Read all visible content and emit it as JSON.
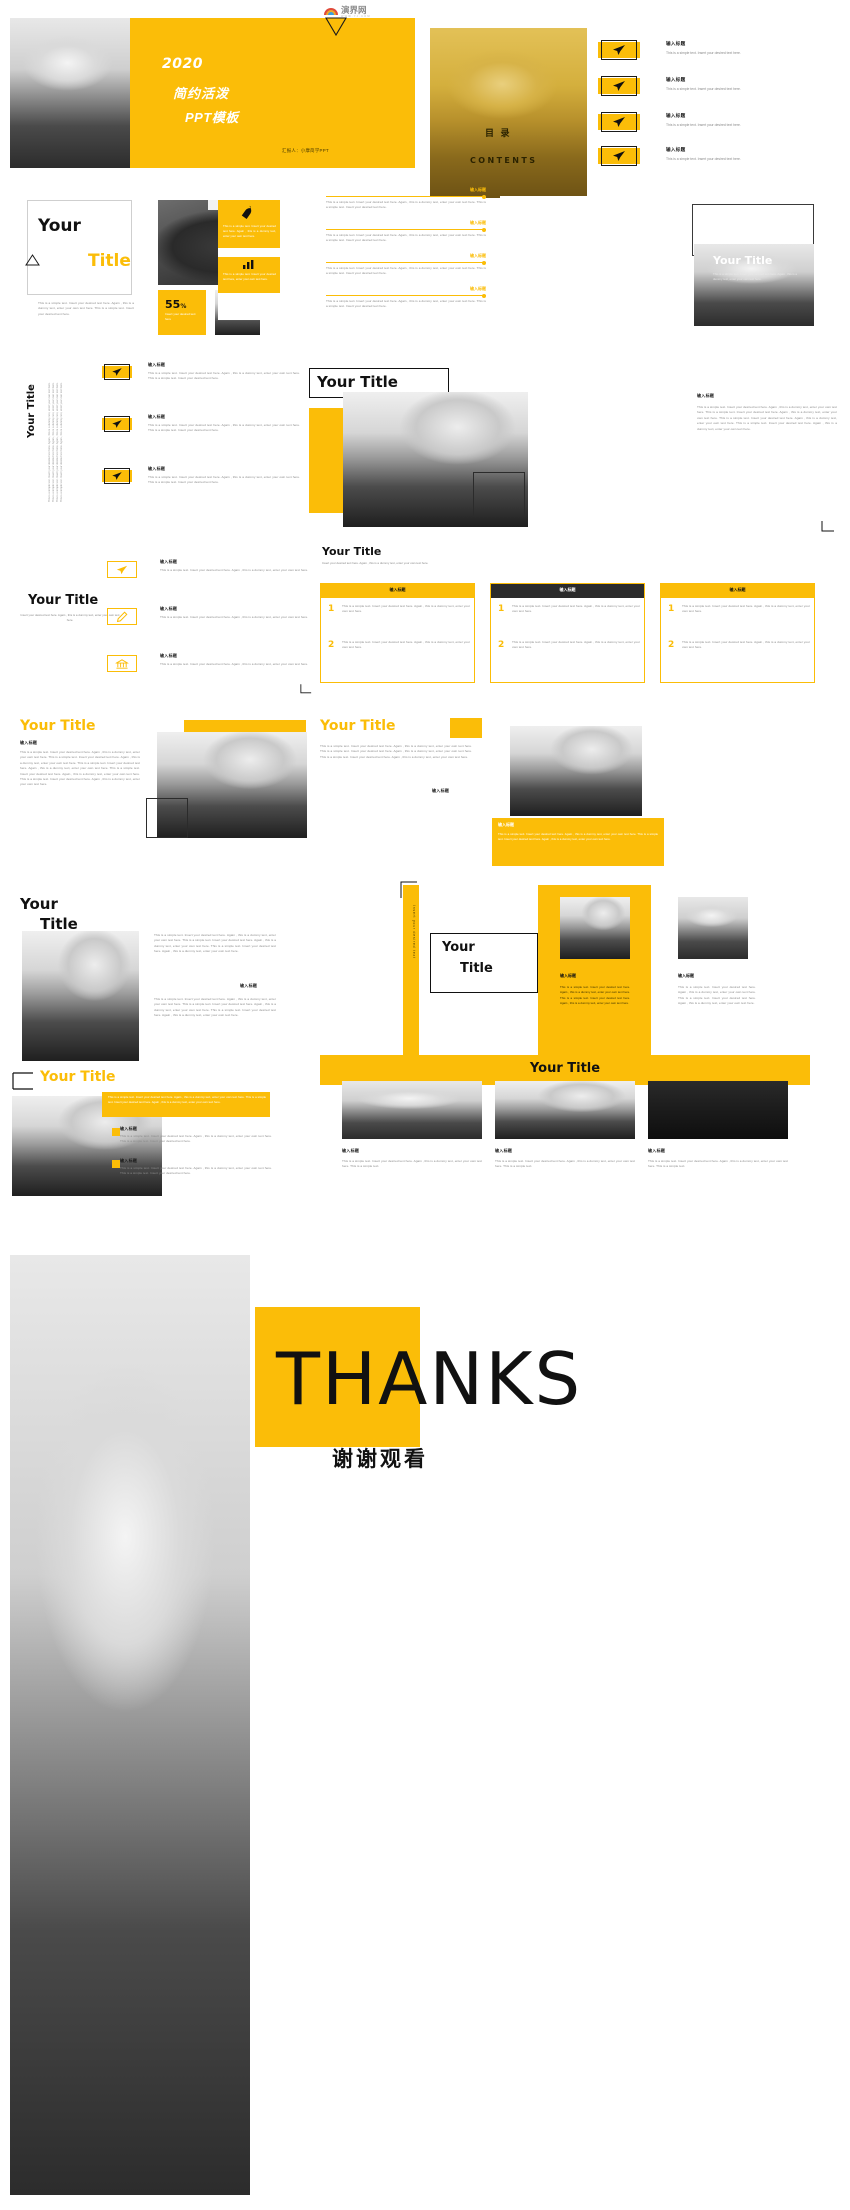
{
  "meta": {
    "watermark": "演界网",
    "watermark_sub": "WWW.YJ.COM"
  },
  "colors": {
    "accent": "#FBBD08",
    "accent_dark": "#E8AE05",
    "ink": "#1a1a1a",
    "muted": "#8a8a8a"
  },
  "lorem": {
    "short": "This is a simple text. Insert your desired text here.",
    "medium": "This is a simple text. Insert your desired text here. Again , this is a dummy text, enter your own text here.",
    "long": "This is a simple text. Insert your desired text here. Again , this is a dummy text, enter your own text here. This is a simple text. Insert your desired text here. Again , this is a dummy text, enter your own text here.",
    "xlong": "This is a simple text. Insert your desired text here. Again , this is a dummy text, enter your own text here. This is a simple text. Insert your desired text here. Again , this is a dummy text, enter your own text here. This is a simple text. Insert your desired text here. Again , this is a dummy text, enter your own text here.",
    "vertical": "Insert your desired text"
  },
  "slide_cover": {
    "year": "2020",
    "line2": "简约活泼",
    "line3": "PPT模板",
    "author": "汇报人：小摩简学PPT"
  },
  "slide_contents": {
    "cn": "目  录",
    "en": "CONTENTS",
    "items": [
      {
        "title": "输入标题",
        "desc": "This is a simple text. Insert your desired text here."
      },
      {
        "title": "输入标题",
        "desc": "This is a simple text. Insert your desired text here."
      },
      {
        "title": "输入标题",
        "desc": "This is a simple text. Insert your desired text here."
      },
      {
        "title": "输入标题",
        "desc": "This is a simple text. Insert your desired text here."
      }
    ]
  },
  "slide_yourtitle_bike": {
    "title_1": "Your",
    "title_2": "Title",
    "body": "This is a simple text. Insert your desired text here. Again , this is a dummy text, enter your own text here. This is a simple text. Insert your desired text here.",
    "stat_value": "55",
    "stat_unit": "%",
    "stat_label": "Insert your desired text here",
    "card_text": "This is a simple text. Insert your desired text here. Again , this is a dummy text, enter your own text here.",
    "card2_text": "This is a simple text. Insert your desired text here, enter your own text here."
  },
  "slide_three_bars": {
    "items": [
      {
        "title": "输入标题",
        "body": "This is a simple text. Insert your desired text here. Again , this is a dummy text, enter your own text here. This is a simple text. Insert your desired text here."
      },
      {
        "title": "输入标题",
        "body": "This is a simple text. Insert your desired text here. Again , this is a dummy text, enter your own text here. This is a simple text. Insert your desired text here."
      },
      {
        "title": "输入标题",
        "body": "This is a simple text. Insert your desired text here. Again , this is a dummy text, enter your own text here. This is a simple text. Insert your desired text here."
      },
      {
        "title": "输入标题",
        "body": "This is a simple text. Insert your desired text here. Again , this is a dummy text, enter your own text here. This is a simple text. Insert your desired text here."
      }
    ]
  },
  "slide_photo_title": {
    "title": "Your Title",
    "body": "This is a simple text. Insert your desired text here. Again , this is a dummy text, enter your own text here."
  },
  "slide_icon_list": {
    "title_1": "输入标题",
    "items": [
      {
        "title": "输入标题",
        "body": "This is a simple text. Insert your desired text here. Again , this is a dummy text, enter your own text here. This is a simple text. Insert your desired text here."
      },
      {
        "title": "输入标题",
        "body": "This is a simple text. Insert your desired text here. Again , this is a dummy text, enter your own text here. This is a simple text. Insert your desired text here."
      },
      {
        "title": "输入标题",
        "body": "This is a simple text. Insert your desired text here. Again , this is a dummy text, enter your own text here. This is a simple text. Insert your desired text here."
      }
    ]
  },
  "slide_horse_big": {
    "title": "Your Title",
    "body": "This is a simple text. Insert your desired text here. Again , this is a dummy text, enter your own text here. This is a simple text. Insert your desired text here. Again , this is a dummy text, enter your own text here. This is a simple text. Insert your desired text here. Again , this is a dummy text, enter your own text here. This is a simple text. Insert your desired text here. Again , this is a dummy text, enter your own text here."
  },
  "slide_left_icons": {
    "title": "Your Title",
    "subtitle": "Insert your desired text here. Again , this is a dummy text, enter your own text here.",
    "icons": [
      "paper-plane-icon",
      "edit-icon",
      "bank-icon"
    ],
    "items": [
      {
        "title": "输入标题",
        "body": "This is a simple text. Insert your desired text here. Again , this is a dummy text, enter your own text here."
      },
      {
        "title": "输入标题",
        "body": "This is a simple text. Insert your desired text here. Again , this is a dummy text, enter your own text here."
      },
      {
        "title": "输入标题",
        "body": "This is a simple text. Insert your desired text here. Again , this is a dummy text, enter your own text here."
      }
    ]
  },
  "slide_three_cards": {
    "title": "Your Title",
    "subtitle": "Insert your desired text here. Again , this is a dummy text, enter your own text here.",
    "cards": [
      {
        "header": "输入标题",
        "header_style": "yellow",
        "rows": [
          {
            "num": "1",
            "body": "This is a simple text. Insert your desired text here. Again , this is a dummy text, enter your own text here."
          },
          {
            "num": "2",
            "body": "This is a simple text. Insert your desired text here. Again , this is a dummy text, enter your own text here."
          }
        ]
      },
      {
        "header": "输入标题",
        "header_style": "dark",
        "rows": [
          {
            "num": "1",
            "body": "This is a simple text. Insert your desired text here. Again , this is a dummy text, enter your own text here."
          },
          {
            "num": "2",
            "body": "This is a simple text. Insert your desired text here. Again , this is a dummy text, enter your own text here."
          }
        ]
      },
      {
        "header": "输入标题",
        "header_style": "yellow",
        "rows": [
          {
            "num": "1",
            "body": "This is a simple text. Insert your desired text here. Again , this is a dummy text, enter your own text here."
          },
          {
            "num": "2",
            "body": "This is a simple text. Insert your desired text here. Again , this is a dummy text, enter your own text here."
          }
        ]
      }
    ]
  },
  "slide_yellowtitle_left": {
    "title": "Your Title",
    "sub": "输入标题",
    "body": "This is a simple text. Insert your desired text here. Again , this is a dummy text, enter your own text here. This is a simple text. Insert your desired text here. Again , this is a dummy text, enter your own text here. This is a simple text. Insert your desired text here. Again , this is a dummy text, enter your own text here. This is a simple text. Insert your desired text here. Again , this is a dummy text, enter your own text here. This is a simple text. Insert your desired text here. Again , this is a dummy text, enter your own text here."
  },
  "slide_yellowtitle_right": {
    "title": "Your Title",
    "body": "This is a simple text. Insert your desired text here. Again , this is a dummy text, enter your own text here. This is a simple text. Insert your desired text here. Again , this is a dummy text, enter your own text here. This is a simple text. Insert your desired text here. Again , this is a dummy text, enter your own text here.",
    "sub": "输入标题",
    "panel_title": "输入标题",
    "panel_body": "This is a simple text. Insert your desired text here. Again , this is a dummy text, enter your own text here. This is a simple text. Insert your desired text here. Again , this is a dummy text, enter your own text here."
  },
  "slide_horse_text": {
    "title_1": "Your",
    "title_2": "Title",
    "body_1": "This is a simple text. Insert your desired text here. Again , this is a dummy text, enter your own text here. This is a simple text. Insert your desired text here. Again , this is a dummy text, enter your own text here. This is a simple text. Insert your desired text here. Again , this is a dummy text, enter your own text here.",
    "sub": "输入标题",
    "body_2": "This is a simple text. Insert your desired text here. Again , this is a dummy text, enter your own text here. This is a simple text. Insert your desired text here. Again , this is a dummy text, enter your own text here. This is a simple text. Insert your desired text here. Again , this is a dummy text, enter your own text here."
  },
  "slide_vertical": {
    "vtext": "Insert your desired text",
    "title_1": "Your",
    "title_2": "Title",
    "col_a_title": "输入标题",
    "col_a_body": "This is a simple text. Insert your desired text here. Again , this is a dummy text, enter your own text here. This is a simple text. Insert your desired text here. Again , this is a dummy text, enter your own text here.",
    "col_b_title": "输入标题",
    "col_b_body": "This is a simple text. Insert your desired text here. Again , this is a dummy text, enter your own text here. This is a simple text. Insert your desired text here. Again , this is a dummy text, enter your own text here."
  },
  "slide_bottom_left": {
    "title": "Your Title",
    "panel_body": "This is a simple text. Insert your desired text here. Again , this is a dummy text, enter your own text here. This is a simple text. Insert your desired text here. Again , this is a dummy text, enter your own text here.",
    "items": [
      {
        "title": "输入标题",
        "body": "This is a simple text. Insert your desired text here. Again , this is a dummy text, enter your own text here. This is a simple text. Insert your desired text here."
      },
      {
        "title": "输入标题",
        "body": "This is a simple text. Insert your desired text here. Again , this is a dummy text, enter your own text here. This is a simple text. Insert your desired text here."
      }
    ]
  },
  "slide_bottom_right": {
    "title": "Your Title",
    "cards": [
      {
        "title": "输入标题",
        "body": "This is a simple text. Insert your desired text here. Again , this is a dummy text, enter your own text here. This is a simple text."
      },
      {
        "title": "输入标题",
        "body": "This is a simple text. Insert your desired text here. Again , this is a dummy text, enter your own text here. This is a simple text."
      },
      {
        "title": "输入标题",
        "body": "This is a simple text. Insert your desired text here. Again , this is a dummy text, enter your own text here. This is a simple text."
      }
    ]
  },
  "slide_thanks": {
    "title": "THANKS",
    "subtitle": "谢谢观看"
  }
}
